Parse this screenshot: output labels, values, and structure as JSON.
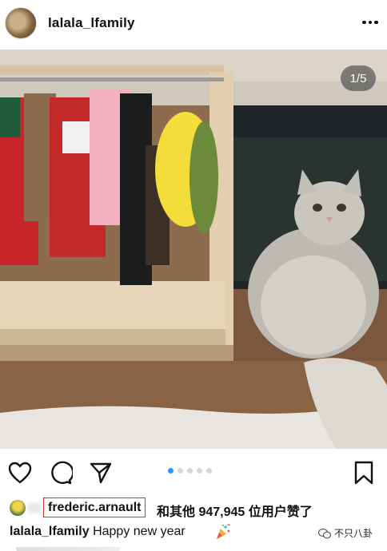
{
  "header": {
    "username": "lalala_lfamily",
    "more_icon": "more-horizontal-icon"
  },
  "post": {
    "image_counter": "1/5",
    "carousel": {
      "total": 5,
      "active_index": 0
    }
  },
  "actions": {
    "like_icon": "heart-icon",
    "comment_icon": "comment-icon",
    "share_icon": "send-icon",
    "save_icon": "bookmark-icon"
  },
  "likes": {
    "liker_name": "frederic.arnault",
    "rest": "和其他 947,945 位用户赞了"
  },
  "caption": {
    "username": "lalala_lfamily",
    "text": "Happy new year",
    "emoji_icon": "party-popper-icon"
  },
  "watermark": {
    "text": "不只八卦"
  },
  "colors": {
    "accent_blue": "#2e97f2",
    "highlight_red": "#e0302c"
  }
}
